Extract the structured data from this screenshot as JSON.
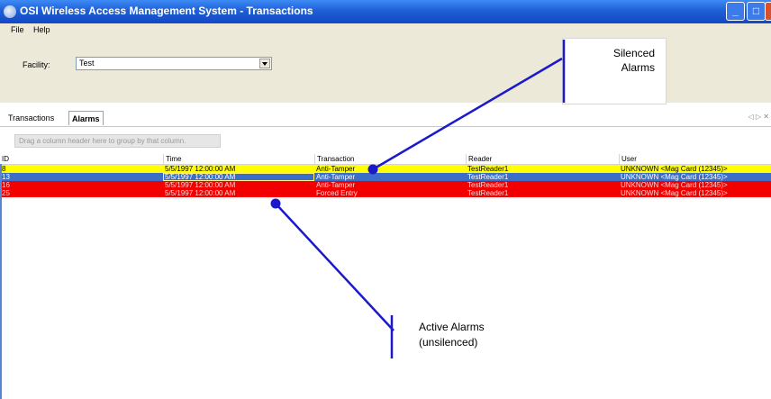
{
  "window": {
    "title": "OSI Wireless Access Management System - Transactions",
    "buttons": {
      "minimize": "_",
      "maximize": "□",
      "close": "X"
    }
  },
  "menu": {
    "items": [
      "File",
      "Help"
    ]
  },
  "facility": {
    "label": "Facility:",
    "value": "Test"
  },
  "tabs": {
    "items": [
      "Transactions",
      "Alarms"
    ],
    "active": "Alarms",
    "nav": "◁ ▷ ✕"
  },
  "grid": {
    "group_hint": "Drag a column header here to group by that column.",
    "columns": [
      "ID",
      "Time",
      "Transaction",
      "Reader",
      "User"
    ],
    "rows": [
      {
        "id": "8",
        "time": "5/5/1997 12:00:00 AM",
        "transaction": "Anti-Tamper",
        "reader": "TestReader1",
        "user": "UNKNOWN <Mag Card (12345)>",
        "status": "silenced"
      },
      {
        "id": "13",
        "time": "5/5/1997 12:00:00 AM",
        "transaction": "Anti-Tamper",
        "reader": "TestReader1",
        "user": "UNKNOWN <Mag Card (12345)>",
        "status": "selected"
      },
      {
        "id": "16",
        "time": "5/5/1997 12:00:00 AM",
        "transaction": "Anti-Tamper",
        "reader": "TestReader1",
        "user": "UNKNOWN <Mag Card (12345)>",
        "status": "active"
      },
      {
        "id": "25",
        "time": "5/5/1997 12:00:00 AM",
        "transaction": "Forced Entry",
        "reader": "TestReader1",
        "user": "UNKNOWN <Mag Card (12345)>",
        "status": "active"
      }
    ]
  },
  "annotations": {
    "silenced": "Silenced\nAlarms",
    "active": "Active Alarms\n(unsilenced)"
  },
  "colors": {
    "silenced": "#ffff00",
    "selected": "#3c6ec8",
    "active": "#f20000",
    "annotation_line": "#1a1acc"
  }
}
